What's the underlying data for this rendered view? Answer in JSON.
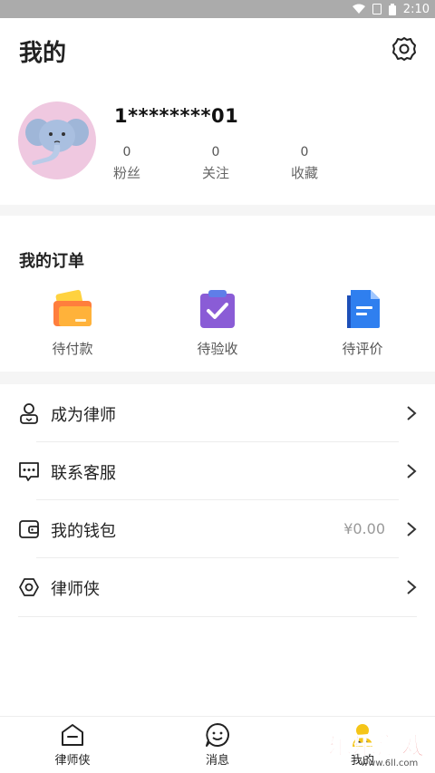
{
  "status_bar": {
    "time": "2:10"
  },
  "header": {
    "title": "我的",
    "settings_icon": "gear-icon"
  },
  "profile": {
    "username": "1********01",
    "stats": [
      {
        "value": "0",
        "label": "粉丝"
      },
      {
        "value": "0",
        "label": "关注"
      },
      {
        "value": "0",
        "label": "收藏"
      }
    ]
  },
  "orders": {
    "title": "我的订单",
    "items": [
      {
        "label": "待付款",
        "icon": "wallet-card-icon",
        "color": "#f5a623"
      },
      {
        "label": "待验收",
        "icon": "clipboard-check-icon",
        "color": "#8a5cd6"
      },
      {
        "label": "待评价",
        "icon": "document-icon",
        "color": "#2f6fe0"
      }
    ]
  },
  "menu": [
    {
      "label": "成为律师",
      "value": "",
      "icon": "person-badge-icon"
    },
    {
      "label": "联系客服",
      "value": "",
      "icon": "chat-dots-icon"
    },
    {
      "label": "我的钱包",
      "value": "¥0.00",
      "icon": "wallet-icon"
    },
    {
      "label": "律师侠",
      "value": "",
      "icon": "hexagon-icon"
    }
  ],
  "tabbar": {
    "tabs": [
      {
        "label": "律师侠",
        "icon": "home-icon"
      },
      {
        "label": "消息",
        "icon": "smile-chat-icon"
      },
      {
        "label": "我的",
        "icon": "user-icon",
        "active": true
      }
    ]
  },
  "watermark": {
    "text": "乐乐游戏",
    "url": "www.6ll.com"
  },
  "colors": {
    "accent": "#f5c518",
    "text": "#222222",
    "muted": "#999999"
  }
}
